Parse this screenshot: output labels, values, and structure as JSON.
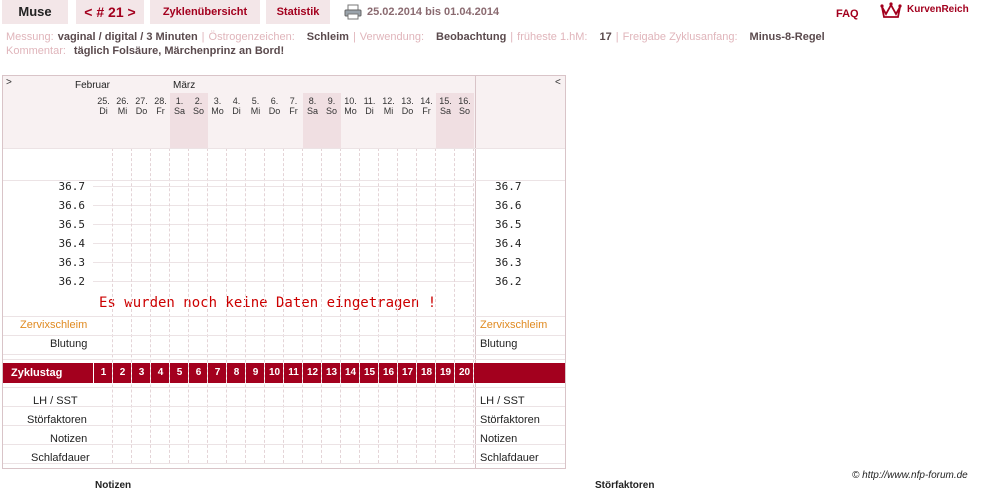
{
  "topbar": {
    "user": "Muse",
    "cycle_nav": "< # 21 >",
    "tab_overview": "Zyklenübersicht",
    "tab_stats": "Statistik",
    "date_range": "25.02.2014 bis 01.04.2014",
    "faq": "FAQ",
    "brand": "KurvenReich",
    "icons": {
      "print": "printer-icon",
      "logo": "crown-icon"
    }
  },
  "info": {
    "messung_label": "Messung:",
    "messung_value": "vaginal / digital / 3 Minuten",
    "oestrogen_label": "Östrogenzeichen:",
    "oestrogen_value": "Schleim",
    "verwendung_label": "Verwendung:",
    "verwendung_value": "Beobachtung",
    "fh_label": "früheste 1.hM:",
    "fh_value": "17",
    "freigabe_label": "Freigabe Zyklusanfang:",
    "freigabe_value": "Minus-8-Regel",
    "kommentar_label": "Kommentar:",
    "kommentar_value": "täglich Folsäure, Märchenprinz an Bord!"
  },
  "chart": {
    "nav_left": ">",
    "nav_right": "<",
    "month1": "Februar",
    "month2": "März",
    "days": [
      {
        "d": "25.",
        "w": "Di"
      },
      {
        "d": "26.",
        "w": "Mi"
      },
      {
        "d": "27.",
        "w": "Do"
      },
      {
        "d": "28.",
        "w": "Fr"
      },
      {
        "d": "1.",
        "w": "Sa"
      },
      {
        "d": "2.",
        "w": "So"
      },
      {
        "d": "3.",
        "w": "Mo"
      },
      {
        "d": "4.",
        "w": "Di"
      },
      {
        "d": "5.",
        "w": "Mi"
      },
      {
        "d": "6.",
        "w": "Do"
      },
      {
        "d": "7.",
        "w": "Fr"
      },
      {
        "d": "8.",
        "w": "Sa"
      },
      {
        "d": "9.",
        "w": "So"
      },
      {
        "d": "10.",
        "w": "Mo"
      },
      {
        "d": "11.",
        "w": "Di"
      },
      {
        "d": "12.",
        "w": "Mi"
      },
      {
        "d": "13.",
        "w": "Do"
      },
      {
        "d": "14.",
        "w": "Fr"
      },
      {
        "d": "15.",
        "w": "Sa"
      },
      {
        "d": "16.",
        "w": "So"
      }
    ],
    "temps": [
      "36.7",
      "36.6",
      "36.5",
      "36.4",
      "36.3",
      "36.2"
    ],
    "no_data": "Es wurden noch keine Daten eingetragen !",
    "row_zervix": "Zervixschleim",
    "row_blutung": "Blutung",
    "zyklustag_label": "Zyklustag",
    "zyklustage": [
      "1",
      "2",
      "3",
      "4",
      "5",
      "6",
      "7",
      "8",
      "9",
      "10",
      "11",
      "12",
      "13",
      "14",
      "15",
      "16",
      "17",
      "18",
      "19",
      "20"
    ],
    "row_lh": "LH / SST",
    "row_stoer": "Störfaktoren",
    "row_notizen": "Notizen",
    "row_schlaf": "Schlafdauer"
  },
  "footer": {
    "copyright": "© http://www.nfp-forum.de",
    "cut_notizen": "Notizen",
    "cut_stoer": "Störfaktoren"
  },
  "colors": {
    "accent": "#a3001e",
    "tab_bg": "#f3e6e8",
    "weekend": "#f0dfe2",
    "label_pink": "#e0b5bb",
    "orange": "#e08a20"
  }
}
